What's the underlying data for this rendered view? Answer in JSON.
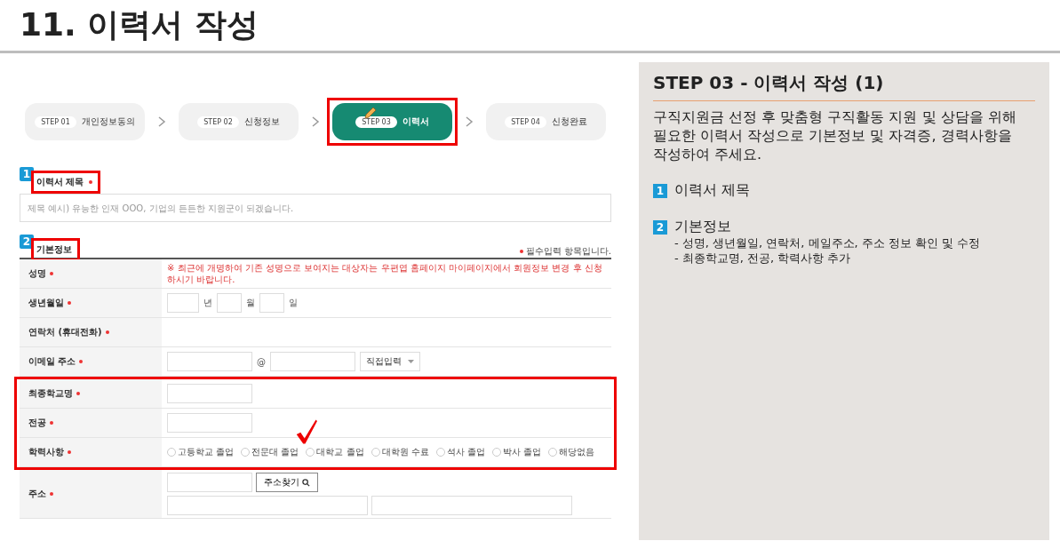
{
  "page_title": "11. 이력서 작성",
  "steps": [
    {
      "chip": "STEP 01",
      "label": "개인정보동의",
      "selected": false,
      "highlighted": false
    },
    {
      "chip": "STEP 02",
      "label": "신청정보",
      "selected": false,
      "highlighted": false
    },
    {
      "chip": "STEP 03",
      "label": "이력서",
      "selected": true,
      "highlighted": true
    },
    {
      "chip": "STEP 04",
      "label": "신청완료",
      "selected": false,
      "highlighted": false
    }
  ],
  "title_section": {
    "badge": "1",
    "label": "이력서 제목",
    "required": true,
    "highlighted": true,
    "placeholder": "제목 예시) 유능한 인재 OOO, 기업의 든든한 지원군이 되겠습니다."
  },
  "basic_section": {
    "badge": "2",
    "label": "기본정보",
    "highlighted": true,
    "note": "필수입력 항목입니다.",
    "rows": [
      {
        "label": "성명",
        "required": true,
        "kind": "notice",
        "highlighted": false,
        "notice": "※ 최근에 개명하여 기존 성명으로 보여지는 대상자는 우편엽 홈페이지 마이페이지에서 회원정보 변경 후 신청하시기 바랍니다."
      },
      {
        "label": "생년월일",
        "required": true,
        "kind": "date",
        "highlighted": false,
        "units": [
          "년",
          "월",
          "일"
        ]
      },
      {
        "label": "연락처 (휴대전화)",
        "required": true,
        "kind": "empty",
        "highlighted": false
      },
      {
        "label": "이메일 주소",
        "required": true,
        "kind": "email",
        "highlighted": false,
        "at": "@",
        "select": "직접입력"
      },
      {
        "label": "최종학교명",
        "required": true,
        "kind": "text",
        "highlighted": true
      },
      {
        "label": "전공",
        "required": true,
        "kind": "text",
        "highlighted": true
      },
      {
        "label": "학력사항",
        "required": true,
        "kind": "radio",
        "highlighted": true,
        "options": [
          {
            "label": "고등학교 졸업",
            "selected": false
          },
          {
            "label": "전문대 졸업",
            "selected": false
          },
          {
            "label": "대학교 졸업",
            "selected": false
          },
          {
            "label": "대학원 수료",
            "selected": false
          },
          {
            "label": "석사 졸업",
            "selected": false
          },
          {
            "label": "박사 졸업",
            "selected": false
          },
          {
            "label": "해당없음",
            "selected": false
          }
        ]
      },
      {
        "label": "주소",
        "required": true,
        "kind": "address",
        "highlighted": false,
        "button": "주소찾기"
      }
    ]
  },
  "guide": {
    "heading": "STEP 03 - 이력서 작성 (1)",
    "intro": "구직지원금 선정 후 맞춤형 구직활동 지원 및 상담을 위해 필요한 이력서 작성으로 기본정보 및 자격증, 경력사항을 작성하여 주세요.",
    "items": [
      {
        "badge": "1",
        "title": "이력서 제목"
      },
      {
        "badge": "2",
        "title": "기본정보",
        "details": [
          "- 성명, 생년월일, 연락처, 메일주소, 주소 정보 확인 및 수정",
          "- 최종학교명, 전공, 학력사항 추가"
        ]
      }
    ]
  }
}
